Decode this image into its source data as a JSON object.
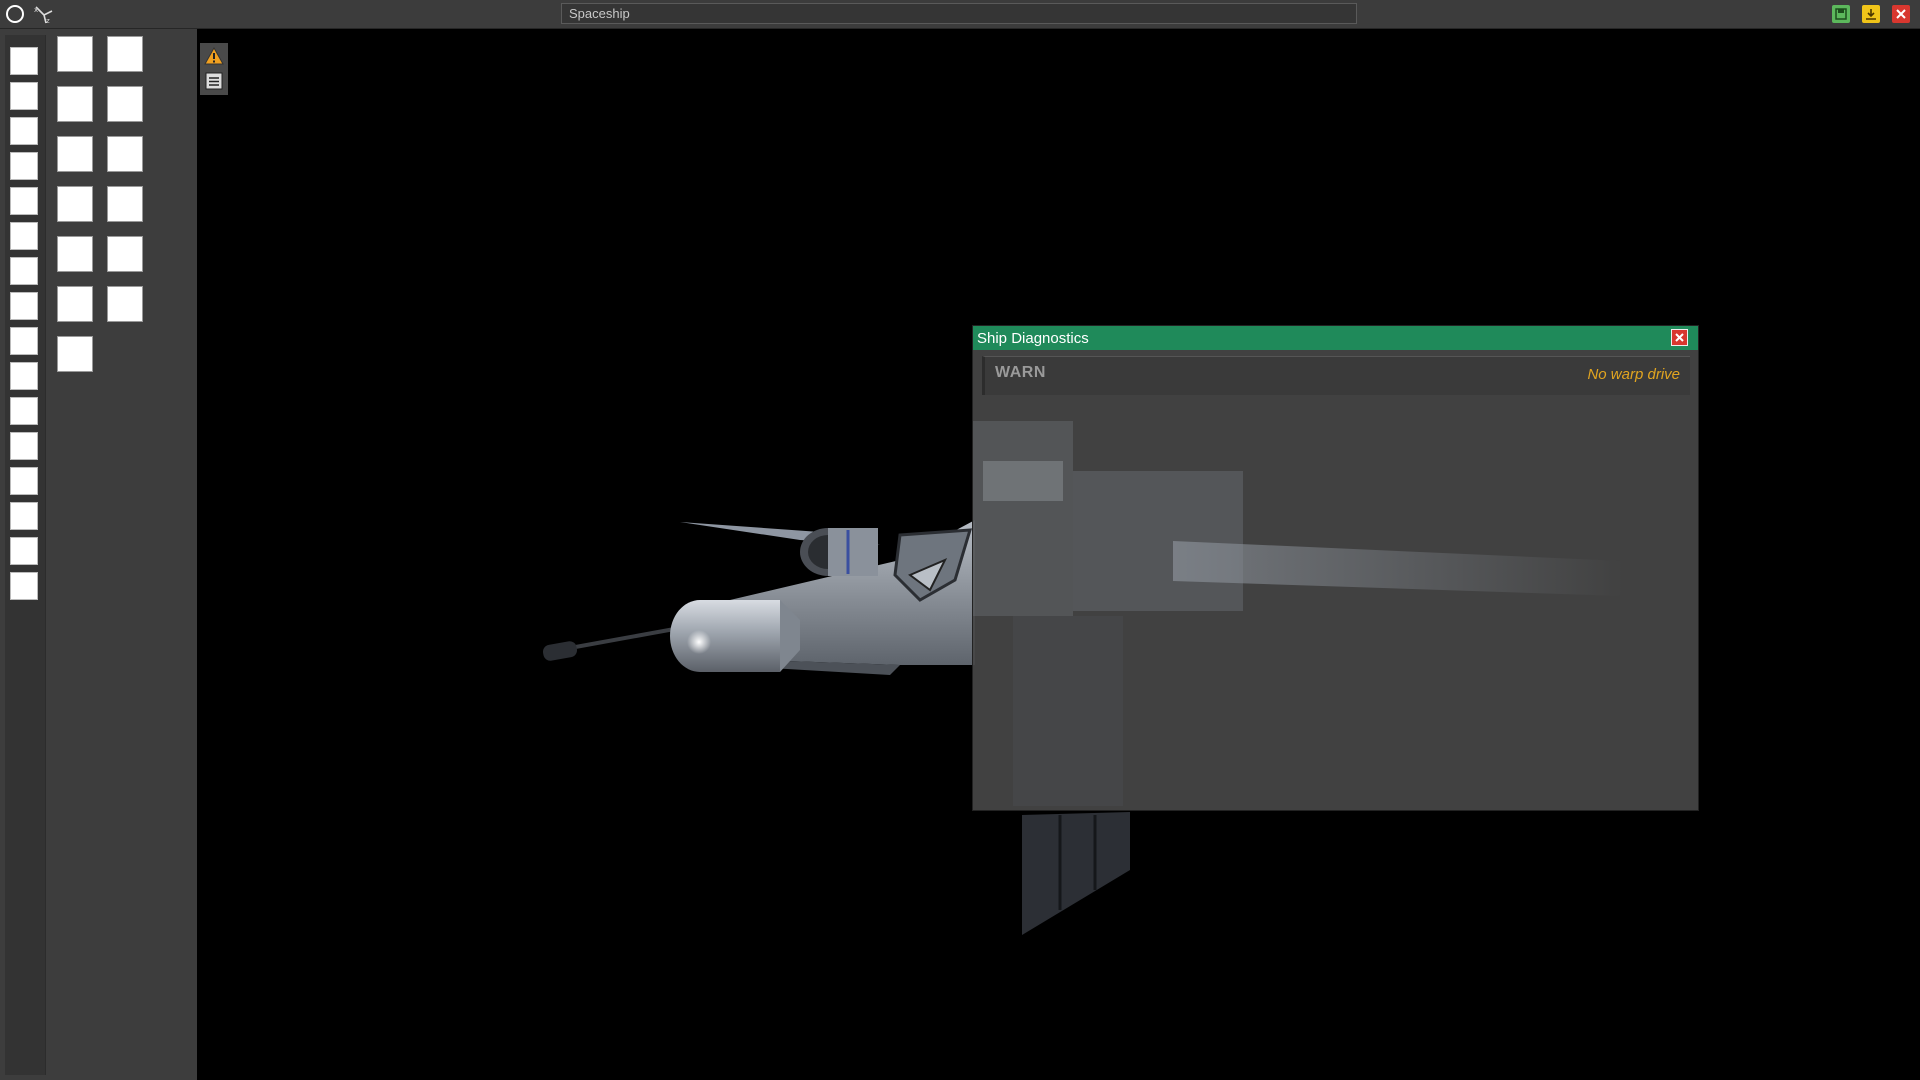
{
  "app": {
    "title": "Spaceship"
  },
  "toolbar": {
    "icons": [
      "circle-icon",
      "axis-gizmo-icon"
    ],
    "window_buttons": [
      {
        "name": "save-icon",
        "color": "#5cb85c"
      },
      {
        "name": "export-icon",
        "color": "#f0c419"
      },
      {
        "name": "close-icon",
        "color": "#d8372f"
      }
    ]
  },
  "left_panel": {
    "slot_column_count": 16,
    "grid_rows": 7,
    "grid_slots": 13
  },
  "tools": [
    "warning-icon",
    "list-icon"
  ],
  "diagnostics": {
    "title": "Ship Diagnostics",
    "entries": [
      {
        "level": "WARN",
        "message": "No warp drive",
        "message_color": "#e2a520"
      }
    ]
  }
}
